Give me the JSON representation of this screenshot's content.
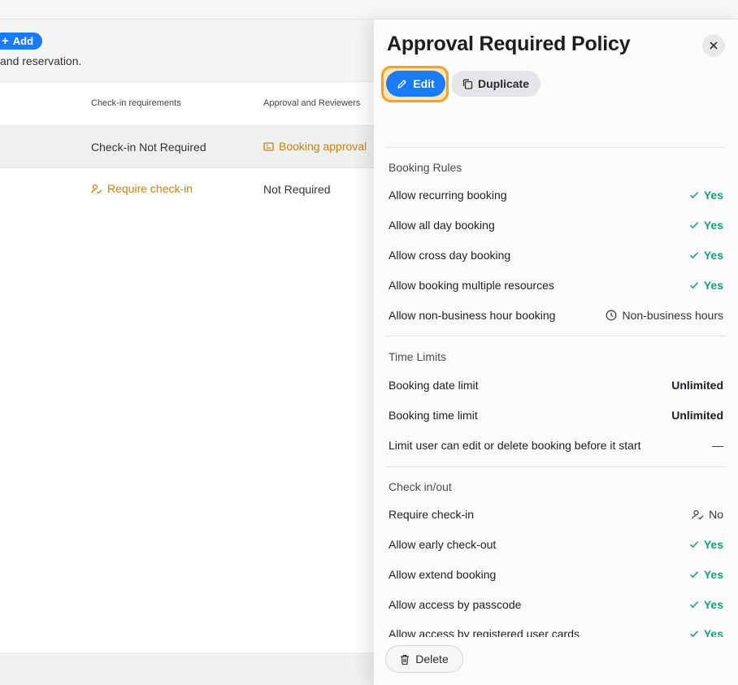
{
  "background": {
    "add_label": "Add",
    "description": "and reservation.",
    "columns": [
      "Check-in requirements",
      "Approval and Reviewers"
    ],
    "rows": [
      {
        "checkin": "Check-in Not Required",
        "approval": "Booking approval"
      },
      {
        "checkin": "Require check-in",
        "approval": "Not Required"
      }
    ]
  },
  "drawer": {
    "title": "Approval Required Policy",
    "edit_label": "Edit",
    "duplicate_label": "Duplicate",
    "delete_label": "Delete",
    "sections": [
      {
        "title": "Booking Rules",
        "items": [
          {
            "label": "Allow recurring booking",
            "value": "Yes"
          },
          {
            "label": "Allow all day booking",
            "value": "Yes"
          },
          {
            "label": "Allow cross day booking",
            "value": "Yes"
          },
          {
            "label": "Allow booking multiple resources",
            "value": "Yes"
          },
          {
            "label": "Allow non-business hour booking",
            "value": "Non-business hours"
          }
        ]
      },
      {
        "title": "Time Limits",
        "items": [
          {
            "label": "Booking date limit",
            "value": "Unlimited"
          },
          {
            "label": "Booking time limit",
            "value": "Unlimited"
          },
          {
            "label": "Limit user can edit or delete booking before it start",
            "value": "—"
          }
        ]
      },
      {
        "title": "Check in/out",
        "items": [
          {
            "label": "Require check-in",
            "value": "No"
          },
          {
            "label": "Allow early check-out",
            "value": "Yes"
          },
          {
            "label": "Allow extend booking",
            "value": "Yes"
          },
          {
            "label": "Allow access by passcode",
            "value": "Yes"
          },
          {
            "label": "Allow access by registered user cards",
            "value": "Yes"
          }
        ]
      }
    ]
  },
  "colors": {
    "accent": "#1a7cf5",
    "focus_ring": "#f6a21e",
    "yes": "#12a474",
    "warning_text": "#c9820f"
  },
  "icons": [
    "plus-icon",
    "booking-approval-icon",
    "user-check-icon",
    "pencil-icon",
    "copy-icon",
    "close-icon",
    "check-icon",
    "clock-icon",
    "trash-icon"
  ]
}
